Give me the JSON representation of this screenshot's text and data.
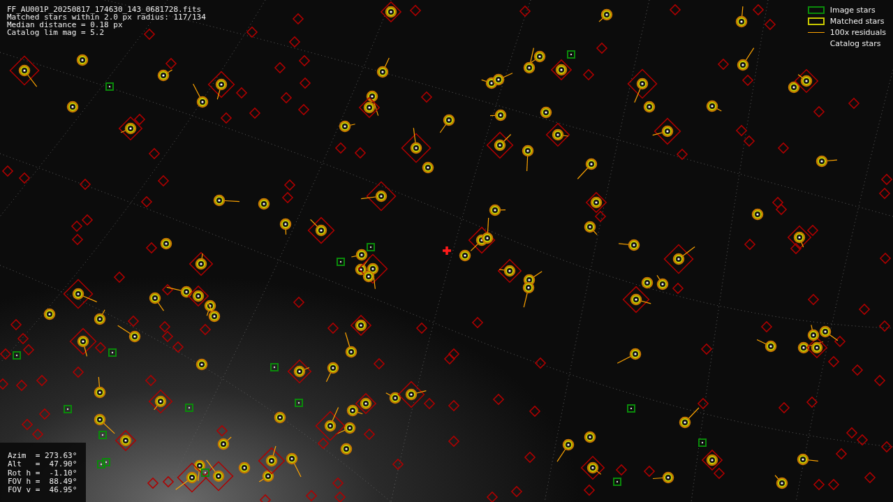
{
  "header": {
    "lines": [
      "FF_AU001P_20250817_174630_143_0681728.fits",
      "Matched stars within 2.0 px radius: 117/134",
      "Median distance = 0.18 px",
      "Catalog lim mag = 5.2"
    ]
  },
  "legend": [
    {
      "label": "Image stars",
      "kind": "image"
    },
    {
      "label": "Matched stars",
      "kind": "matched"
    },
    {
      "label": "100x residuals",
      "kind": "residual"
    },
    {
      "label": "Catalog stars",
      "kind": "catalog"
    }
  ],
  "pointing": {
    "lines": [
      "Azim  = 273.63°",
      "Alt   =  47.90°",
      "Rot h =  -1.10°",
      "FOV h =  88.49°",
      "FOV v =  46.95°"
    ]
  }
}
